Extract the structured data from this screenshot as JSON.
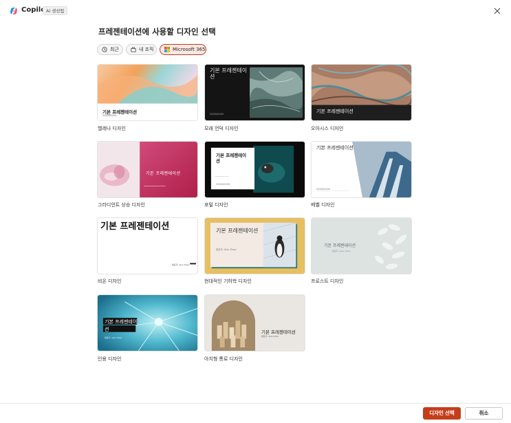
{
  "app": {
    "name": "Copilot",
    "badge": "AI 생성됨"
  },
  "dialog": {
    "title": "프레젠테이션에 사용할 디자인 선택"
  },
  "filters": [
    {
      "label": "최근",
      "icon": "clock-icon",
      "selected": false
    },
    {
      "label": "내 조직",
      "icon": "organization-icon",
      "selected": false
    },
    {
      "label": "Microsoft 365",
      "icon": "microsoft-logo-icon",
      "selected": true
    }
  ],
  "designs": [
    {
      "name": "헬레나 디자인",
      "thumb_title": "기본 프레젠테이션",
      "thumb_sub": "2000/00/00"
    },
    {
      "name": "모래 언덕 디자인",
      "thumb_title": "기본 프레젠테이션",
      "thumb_sub": "2000/00/00"
    },
    {
      "name": "오아시스 디자인",
      "thumb_title": "기본 프레젠테이션",
      "thumb_sub": ""
    },
    {
      "name": "그라디언트 상승 디자인",
      "thumb_title": "기본 프레젠테이션",
      "thumb_sub": ""
    },
    {
      "name": "포털 디자인",
      "thumb_title": "기본 프레젠테이션",
      "thumb_sub": "2000/00/00"
    },
    {
      "name": "베벨 디자인",
      "thumb_title": "기본 프레젠테이션",
      "thumb_sub": "2000/00/00"
    },
    {
      "name": "비온 디자인",
      "thumb_title": "기본 프레젠테이션",
      "thumb_sub": "발표자: Alex Zhao"
    },
    {
      "name": "현대적인 기하학 디자인",
      "thumb_title": "기본 프레젠테이션",
      "thumb_sub": "발표자: Alex Zhao"
    },
    {
      "name": "프로스트 디자인",
      "thumb_title": "기본 프레젠테이션",
      "thumb_sub": "발표자: Jason Zhao"
    },
    {
      "name": "인용 디자인",
      "thumb_title": "기본 프레젠테이션",
      "thumb_sub": "발표자: Alex Zhao"
    },
    {
      "name": "아치형 통로 디자인",
      "thumb_title": "기본 프레젠테이션",
      "thumb_sub": "발표자: Alex Zhao"
    }
  ],
  "buttons": {
    "select": "디자인 선택",
    "cancel": "취소"
  },
  "colors": {
    "accent": "#c43e1c",
    "selected_chip_bg": "#fde7e3"
  }
}
